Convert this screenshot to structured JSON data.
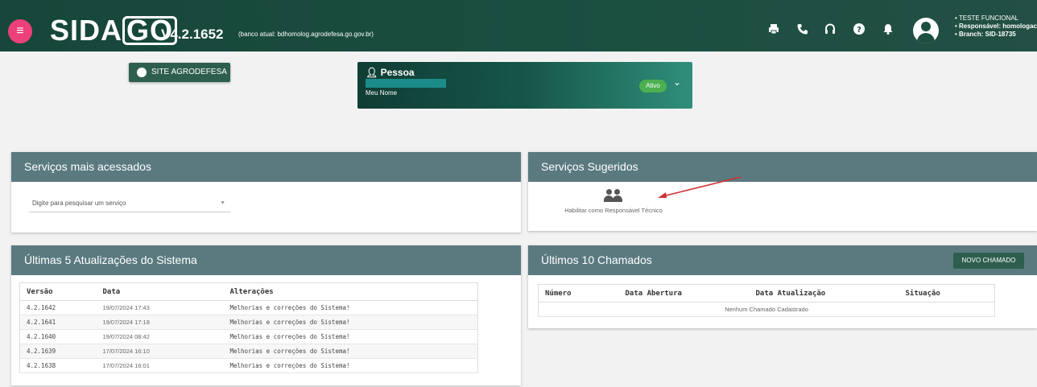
{
  "header": {
    "menu_icon": "menu-icon",
    "logo_main": "SIDA",
    "logo_go": "GO",
    "version": "V4.2.1652",
    "db_info": "(banco atual: bdhomolog.agrodefesa.go.gov.br)",
    "icons": [
      "print-icon",
      "phone-icon",
      "headset-icon",
      "help-icon",
      "bell-icon",
      "account-icon"
    ],
    "user": [
      "TESTE FUNCIONAL",
      "Responsável: homologac",
      "Branch: SID-18735"
    ]
  },
  "site_button": {
    "label": "SITE AGRODEFESA"
  },
  "pessoa": {
    "title": "Pessoa",
    "name": "Meu Nome",
    "status": "Ativo"
  },
  "servicos_acessados": {
    "title": "Serviços mais acessados",
    "search_placeholder": "Digite para pesquisar um serviço"
  },
  "servicos_sugeridos": {
    "title": "Serviços Sugeridos",
    "item": "Habilitar como Responsável Técnico"
  },
  "atualizacoes": {
    "title": "Últimas 5 Atualizações do Sistema",
    "columns": [
      "Versão",
      "Data",
      "Alterações"
    ],
    "rows": [
      [
        "4.2.1642",
        "19/07/2024 17:43",
        "Melhorias e correções do Sistema!"
      ],
      [
        "4.2.1641",
        "19/07/2024 17:18",
        "Melhorias e correções do Sistema!"
      ],
      [
        "4.2.1640",
        "19/07/2024 08:42",
        "Melhorias e correções do Sistema!"
      ],
      [
        "4.2.1639",
        "17/07/2024 16:10",
        "Melhorias e correções do Sistema!"
      ],
      [
        "4.2.1638",
        "17/07/2024 16:01",
        "Melhorias e correções do Sistema!"
      ]
    ]
  },
  "chamados": {
    "title": "Últimos 10 Chamados",
    "new_button": "NOVO CHAMADO",
    "columns": [
      "Número",
      "Data Abertura",
      "Data Atualização",
      "Situação"
    ],
    "empty": "Nenhum Chamado Cadastrado"
  },
  "colors": {
    "header": "#1b4f40",
    "card_header": "#5a7a80",
    "accent": "#ec407a",
    "status": "#4caf50"
  }
}
